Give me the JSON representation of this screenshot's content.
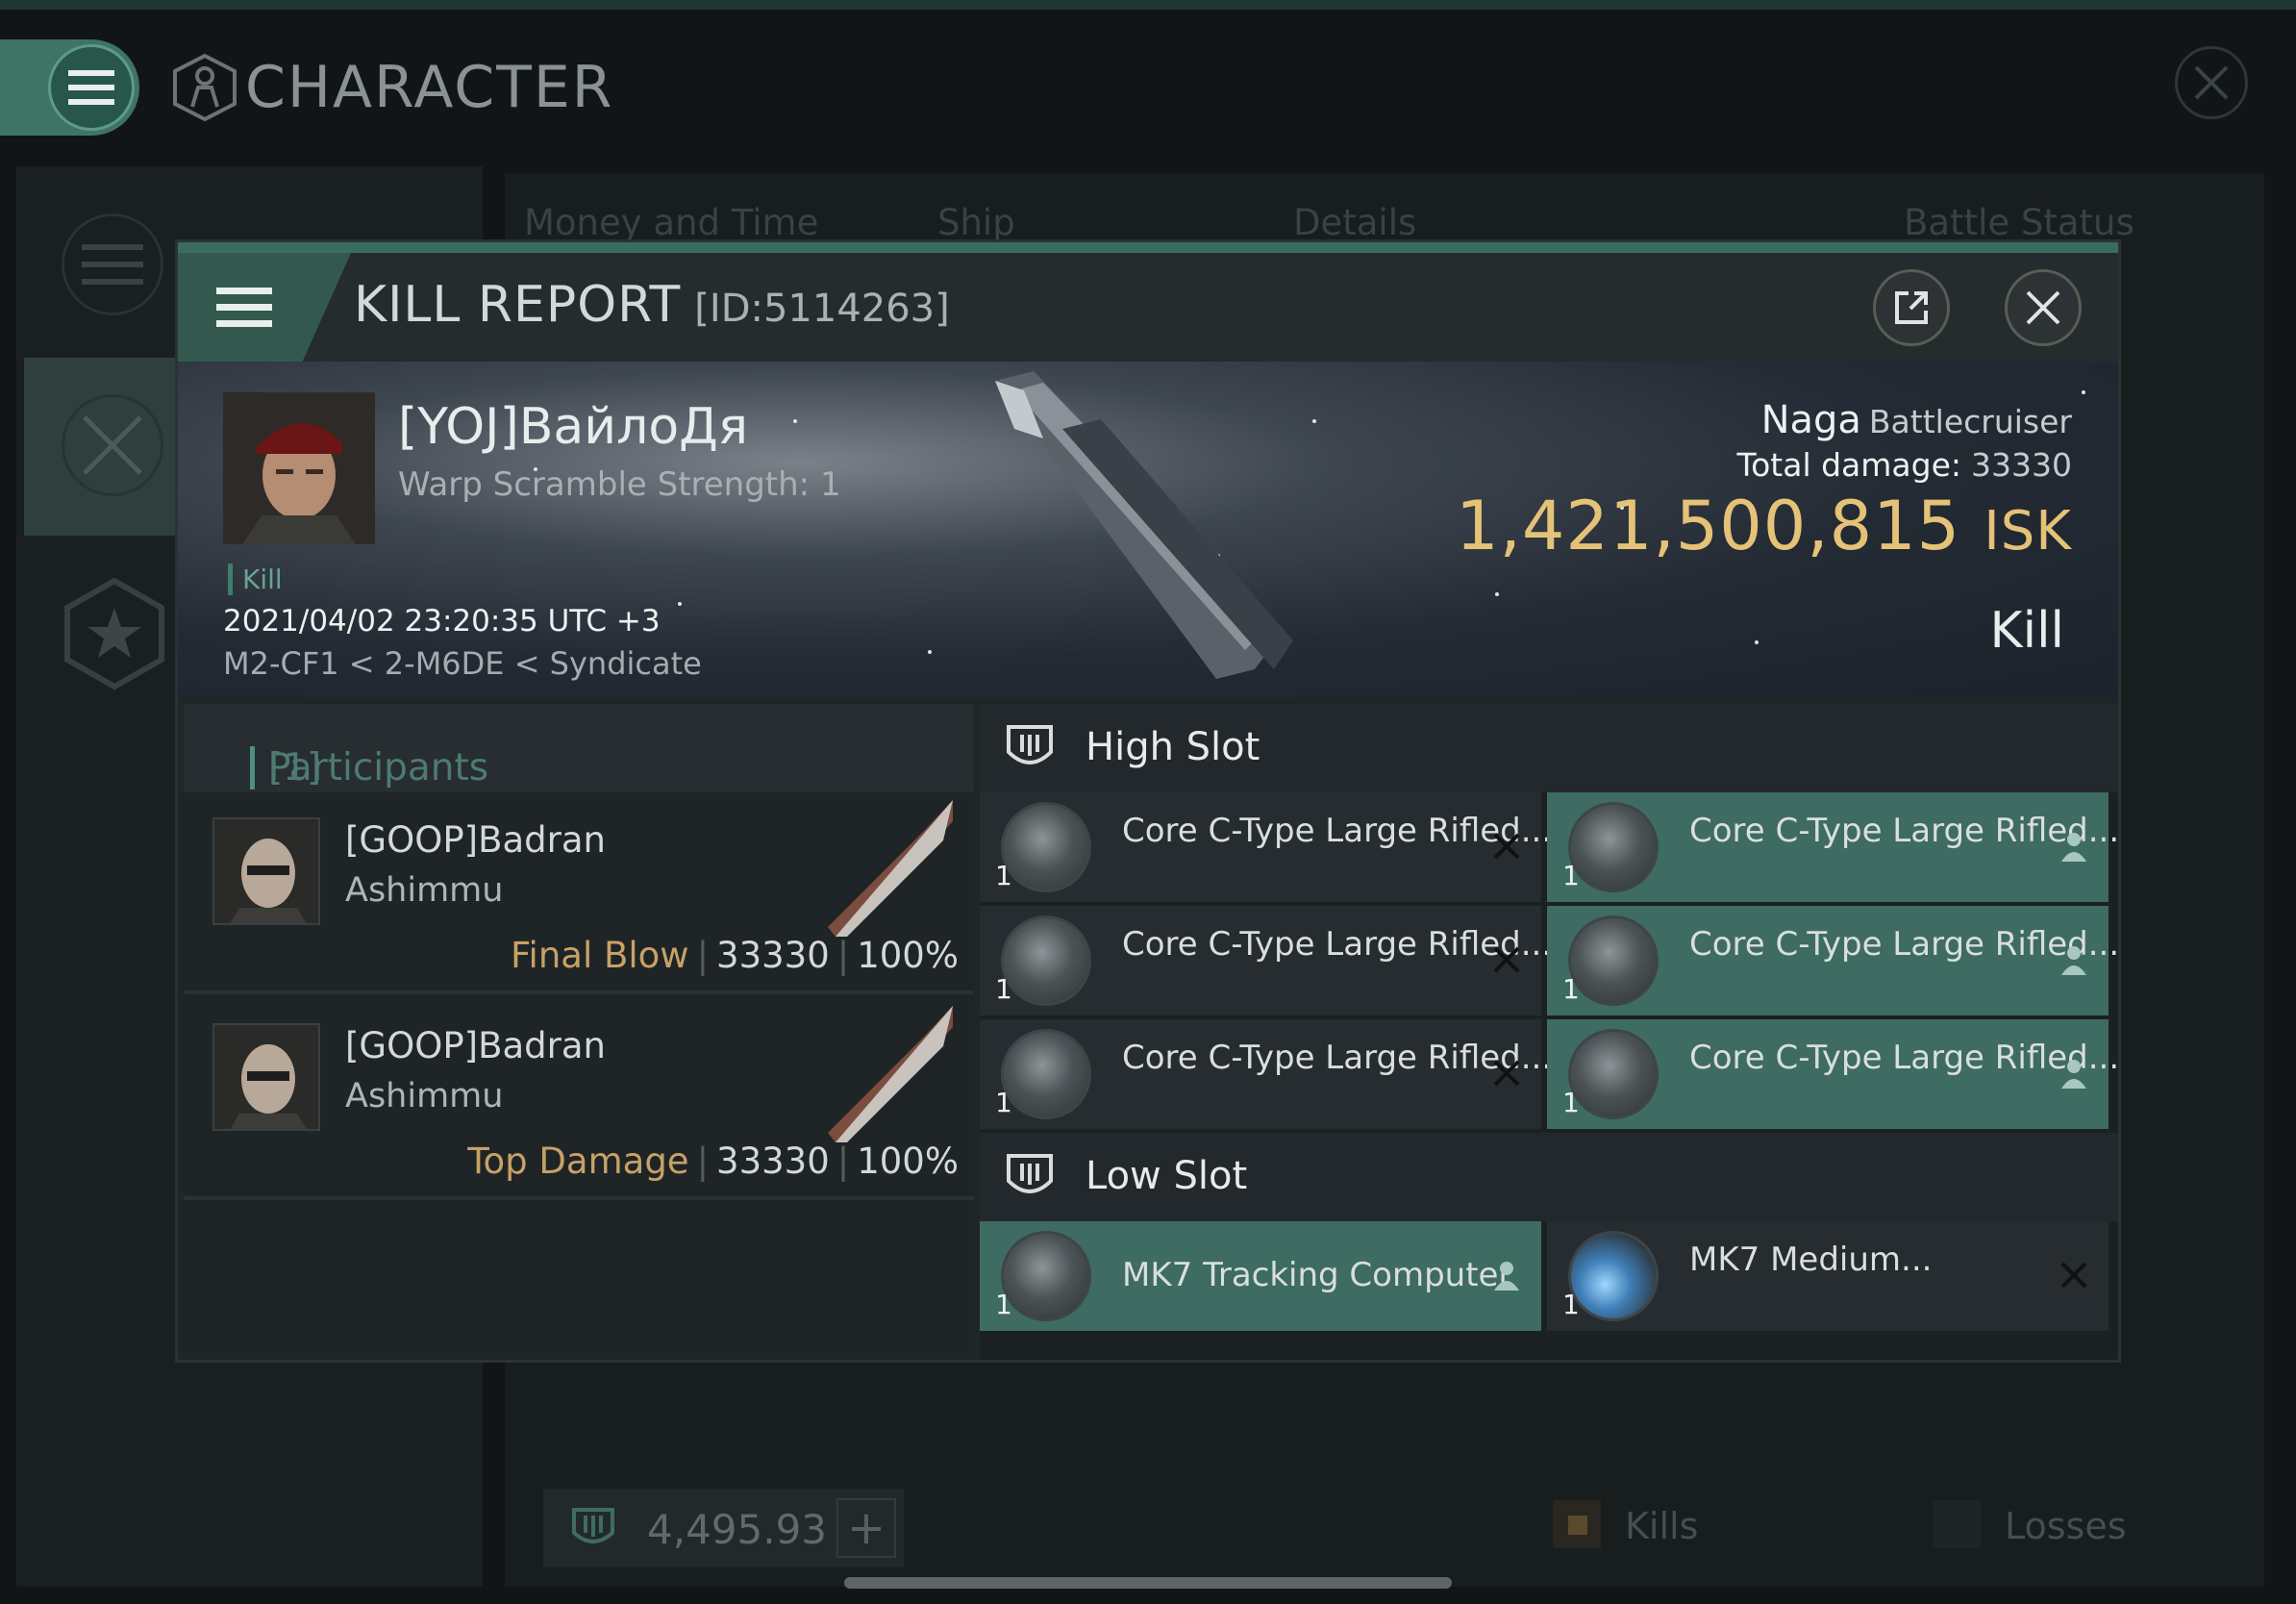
{
  "window": {
    "title": "CHARACTER",
    "tabs": [
      "Money and Time",
      "Ship",
      "Details",
      "Battle Status"
    ],
    "bottom_value": "4,495.93",
    "legend": [
      "Kills",
      "Losses"
    ]
  },
  "kill_report": {
    "title": "KILL REPORT",
    "id_label": "[ID:5114263]",
    "victim": {
      "name": "[YOJ]ВайлоДя",
      "warp_scramble": "Warp Scramble Strength: 1",
      "tag": "Kill",
      "timestamp": "2021/04/02 23:20:35 UTC +3",
      "location": "M2-CF1 < 2-M6DE < Syndicate"
    },
    "ship": {
      "name": "Naga",
      "class": "Battlecruiser",
      "total_damage_label": "Total damage:",
      "total_damage": "33330",
      "isk_value": "1,421,500,815",
      "isk_unit": "ISK",
      "status": "Kill"
    },
    "participants": {
      "label": "Participants",
      "count": "[1]",
      "rows": [
        {
          "name": "[GOOP]Badran",
          "ship": "Ashimmu",
          "role": "Final Blow",
          "damage": "33330",
          "percent": "100%"
        },
        {
          "name": "[GOOP]Badran",
          "ship": "Ashimmu",
          "role": "Top Damage",
          "damage": "33330",
          "percent": "100%"
        }
      ]
    },
    "high_slot": {
      "label": "High Slot",
      "items": [
        {
          "name": "Core C-Type Large Rifled...",
          "qty": "1",
          "state": "destroyed"
        },
        {
          "name": "Core C-Type Large Rifled...",
          "qty": "1",
          "state": "dropped"
        },
        {
          "name": "Core C-Type Large Rifled...",
          "qty": "1",
          "state": "destroyed"
        },
        {
          "name": "Core C-Type Large Rifled...",
          "qty": "1",
          "state": "dropped"
        },
        {
          "name": "Core C-Type Large Rifled...",
          "qty": "1",
          "state": "destroyed"
        },
        {
          "name": "Core C-Type Large Rifled...",
          "qty": "1",
          "state": "dropped"
        }
      ]
    },
    "low_slot": {
      "label": "Low Slot",
      "items": [
        {
          "name": "MK7 Tracking Computer",
          "qty": "1",
          "state": "dropped"
        },
        {
          "name": "MK7 Medium...",
          "qty": "1",
          "state": "destroyed"
        }
      ]
    }
  }
}
